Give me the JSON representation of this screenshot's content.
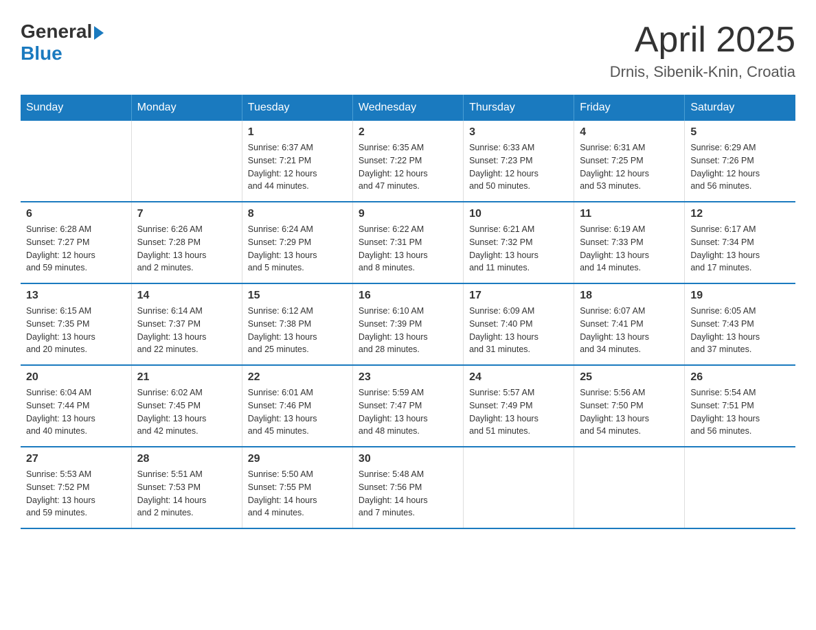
{
  "header": {
    "logo_general": "General",
    "logo_blue": "Blue",
    "month": "April 2025",
    "location": "Drnis, Sibenik-Knin, Croatia"
  },
  "days_of_week": [
    "Sunday",
    "Monday",
    "Tuesday",
    "Wednesday",
    "Thursday",
    "Friday",
    "Saturday"
  ],
  "weeks": [
    [
      {
        "day": "",
        "info": ""
      },
      {
        "day": "",
        "info": ""
      },
      {
        "day": "1",
        "info": "Sunrise: 6:37 AM\nSunset: 7:21 PM\nDaylight: 12 hours\nand 44 minutes."
      },
      {
        "day": "2",
        "info": "Sunrise: 6:35 AM\nSunset: 7:22 PM\nDaylight: 12 hours\nand 47 minutes."
      },
      {
        "day": "3",
        "info": "Sunrise: 6:33 AM\nSunset: 7:23 PM\nDaylight: 12 hours\nand 50 minutes."
      },
      {
        "day": "4",
        "info": "Sunrise: 6:31 AM\nSunset: 7:25 PM\nDaylight: 12 hours\nand 53 minutes."
      },
      {
        "day": "5",
        "info": "Sunrise: 6:29 AM\nSunset: 7:26 PM\nDaylight: 12 hours\nand 56 minutes."
      }
    ],
    [
      {
        "day": "6",
        "info": "Sunrise: 6:28 AM\nSunset: 7:27 PM\nDaylight: 12 hours\nand 59 minutes."
      },
      {
        "day": "7",
        "info": "Sunrise: 6:26 AM\nSunset: 7:28 PM\nDaylight: 13 hours\nand 2 minutes."
      },
      {
        "day": "8",
        "info": "Sunrise: 6:24 AM\nSunset: 7:29 PM\nDaylight: 13 hours\nand 5 minutes."
      },
      {
        "day": "9",
        "info": "Sunrise: 6:22 AM\nSunset: 7:31 PM\nDaylight: 13 hours\nand 8 minutes."
      },
      {
        "day": "10",
        "info": "Sunrise: 6:21 AM\nSunset: 7:32 PM\nDaylight: 13 hours\nand 11 minutes."
      },
      {
        "day": "11",
        "info": "Sunrise: 6:19 AM\nSunset: 7:33 PM\nDaylight: 13 hours\nand 14 minutes."
      },
      {
        "day": "12",
        "info": "Sunrise: 6:17 AM\nSunset: 7:34 PM\nDaylight: 13 hours\nand 17 minutes."
      }
    ],
    [
      {
        "day": "13",
        "info": "Sunrise: 6:15 AM\nSunset: 7:35 PM\nDaylight: 13 hours\nand 20 minutes."
      },
      {
        "day": "14",
        "info": "Sunrise: 6:14 AM\nSunset: 7:37 PM\nDaylight: 13 hours\nand 22 minutes."
      },
      {
        "day": "15",
        "info": "Sunrise: 6:12 AM\nSunset: 7:38 PM\nDaylight: 13 hours\nand 25 minutes."
      },
      {
        "day": "16",
        "info": "Sunrise: 6:10 AM\nSunset: 7:39 PM\nDaylight: 13 hours\nand 28 minutes."
      },
      {
        "day": "17",
        "info": "Sunrise: 6:09 AM\nSunset: 7:40 PM\nDaylight: 13 hours\nand 31 minutes."
      },
      {
        "day": "18",
        "info": "Sunrise: 6:07 AM\nSunset: 7:41 PM\nDaylight: 13 hours\nand 34 minutes."
      },
      {
        "day": "19",
        "info": "Sunrise: 6:05 AM\nSunset: 7:43 PM\nDaylight: 13 hours\nand 37 minutes."
      }
    ],
    [
      {
        "day": "20",
        "info": "Sunrise: 6:04 AM\nSunset: 7:44 PM\nDaylight: 13 hours\nand 40 minutes."
      },
      {
        "day": "21",
        "info": "Sunrise: 6:02 AM\nSunset: 7:45 PM\nDaylight: 13 hours\nand 42 minutes."
      },
      {
        "day": "22",
        "info": "Sunrise: 6:01 AM\nSunset: 7:46 PM\nDaylight: 13 hours\nand 45 minutes."
      },
      {
        "day": "23",
        "info": "Sunrise: 5:59 AM\nSunset: 7:47 PM\nDaylight: 13 hours\nand 48 minutes."
      },
      {
        "day": "24",
        "info": "Sunrise: 5:57 AM\nSunset: 7:49 PM\nDaylight: 13 hours\nand 51 minutes."
      },
      {
        "day": "25",
        "info": "Sunrise: 5:56 AM\nSunset: 7:50 PM\nDaylight: 13 hours\nand 54 minutes."
      },
      {
        "day": "26",
        "info": "Sunrise: 5:54 AM\nSunset: 7:51 PM\nDaylight: 13 hours\nand 56 minutes."
      }
    ],
    [
      {
        "day": "27",
        "info": "Sunrise: 5:53 AM\nSunset: 7:52 PM\nDaylight: 13 hours\nand 59 minutes."
      },
      {
        "day": "28",
        "info": "Sunrise: 5:51 AM\nSunset: 7:53 PM\nDaylight: 14 hours\nand 2 minutes."
      },
      {
        "day": "29",
        "info": "Sunrise: 5:50 AM\nSunset: 7:55 PM\nDaylight: 14 hours\nand 4 minutes."
      },
      {
        "day": "30",
        "info": "Sunrise: 5:48 AM\nSunset: 7:56 PM\nDaylight: 14 hours\nand 7 minutes."
      },
      {
        "day": "",
        "info": ""
      },
      {
        "day": "",
        "info": ""
      },
      {
        "day": "",
        "info": ""
      }
    ]
  ]
}
